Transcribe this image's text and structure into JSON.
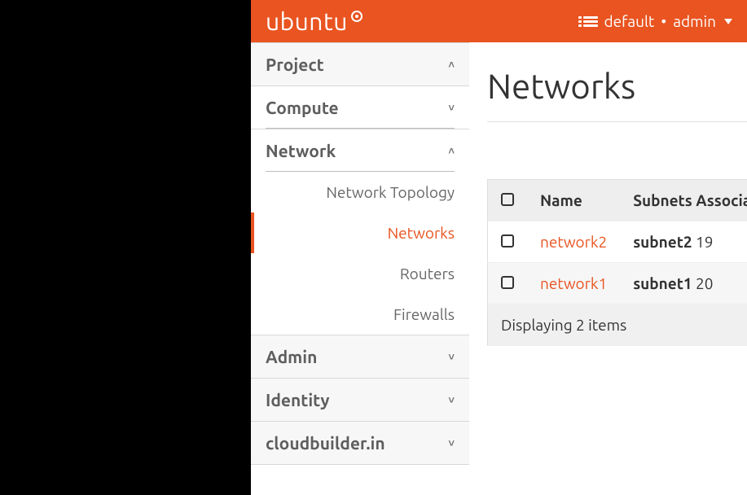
{
  "header": {
    "brand": "ubuntu",
    "domain_label": "default",
    "separator": "•",
    "user_label": "admin"
  },
  "sidebar": {
    "project_label": "Project",
    "compute_label": "Compute",
    "network_label": "Network",
    "network_items": {
      "topology": "Network Topology",
      "networks": "Networks",
      "routers": "Routers",
      "firewalls": "Firewalls"
    },
    "admin_label": "Admin",
    "identity_label": "Identity",
    "cloudbuilder_label": "cloudbuilder.in"
  },
  "page": {
    "title": "Networks"
  },
  "table": {
    "columns": {
      "name": "Name",
      "subnets": "Subnets Associated"
    },
    "rows": [
      {
        "name": "network2",
        "subnet_name": "subnet2",
        "subnet_rest": "19"
      },
      {
        "name": "network1",
        "subnet_name": "subnet1",
        "subnet_rest": "20"
      }
    ],
    "footer": "Displaying 2 items"
  }
}
